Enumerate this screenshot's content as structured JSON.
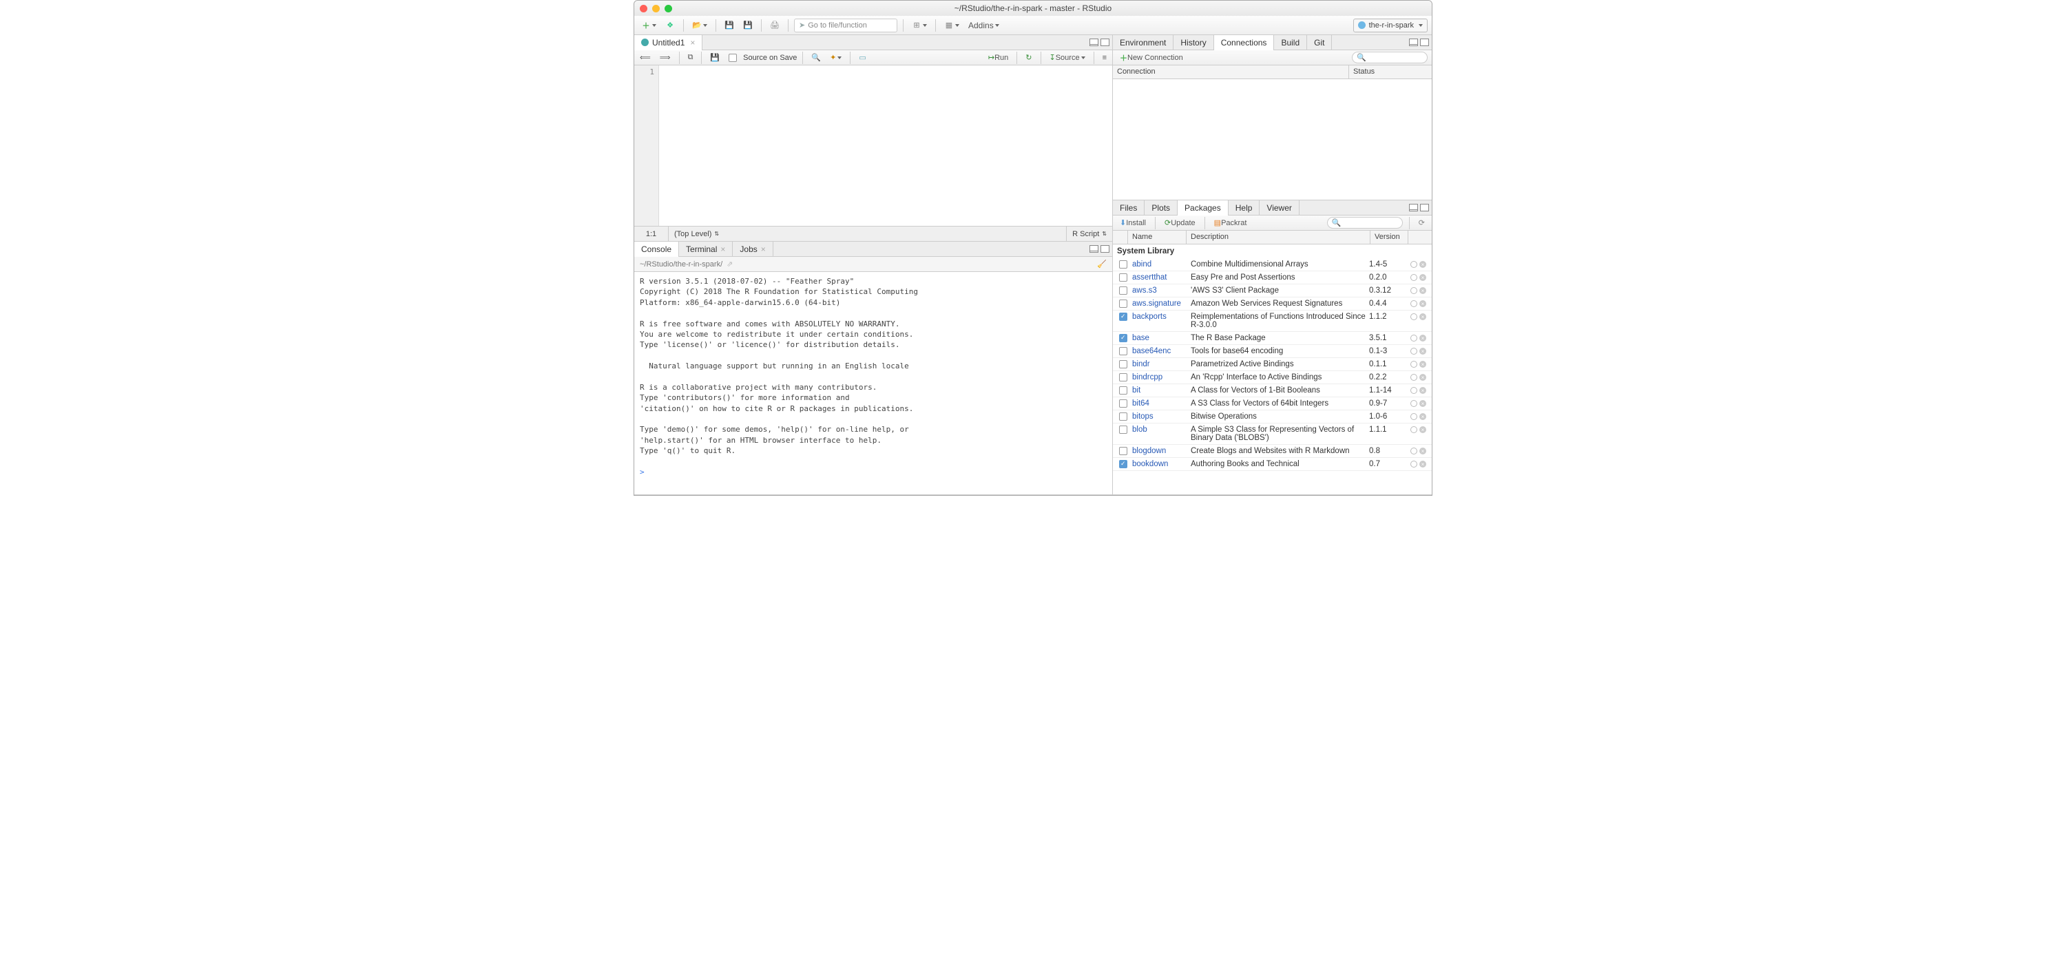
{
  "title": "~/RStudio/the-r-in-spark - master - RStudio",
  "project_name": "the-r-in-spark",
  "mainToolbar": {
    "gotoFile": "Go to file/function",
    "addins": "Addins"
  },
  "source": {
    "tab": "Untitled1",
    "sourceOnSave": "Source on Save",
    "run": "Run",
    "source": "Source",
    "line1": "1",
    "cursor": "1:1",
    "scope": "(Top Level)",
    "type": "R Script"
  },
  "consolePane": {
    "tabs": [
      "Console",
      "Terminal",
      "Jobs"
    ],
    "path": "~/RStudio/the-r-in-spark/",
    "output": "R version 3.5.1 (2018-07-02) -- \"Feather Spray\"\nCopyright (C) 2018 The R Foundation for Statistical Computing\nPlatform: x86_64-apple-darwin15.6.0 (64-bit)\n\nR is free software and comes with ABSOLUTELY NO WARRANTY.\nYou are welcome to redistribute it under certain conditions.\nType 'license()' or 'licence()' for distribution details.\n\n  Natural language support but running in an English locale\n\nR is a collaborative project with many contributors.\nType 'contributors()' for more information and\n'citation()' on how to cite R or R packages in publications.\n\nType 'demo()' for some demos, 'help()' for on-line help, or\n'help.start()' for an HTML browser interface to help.\nType 'q()' to quit R.\n",
    "prompt": ">"
  },
  "env": {
    "tabs": [
      "Environment",
      "History",
      "Connections",
      "Build",
      "Git"
    ],
    "active": "Connections",
    "newConn": "New Connection",
    "cols": [
      "Connection",
      "Status"
    ]
  },
  "pkgs": {
    "tabs": [
      "Files",
      "Plots",
      "Packages",
      "Help",
      "Viewer"
    ],
    "install": "Install",
    "update": "Update",
    "packrat": "Packrat",
    "cols": [
      "Name",
      "Description",
      "Version"
    ],
    "section": "System Library",
    "rows": [
      {
        "c": false,
        "n": "abind",
        "d": "Combine Multidimensional Arrays",
        "v": "1.4-5"
      },
      {
        "c": false,
        "n": "assertthat",
        "d": "Easy Pre and Post Assertions",
        "v": "0.2.0"
      },
      {
        "c": false,
        "n": "aws.s3",
        "d": "'AWS S3' Client Package",
        "v": "0.3.12"
      },
      {
        "c": false,
        "n": "aws.signature",
        "d": "Amazon Web Services Request Signatures",
        "v": "0.4.4"
      },
      {
        "c": true,
        "n": "backports",
        "d": "Reimplementations of Functions Introduced Since R-3.0.0",
        "v": "1.1.2"
      },
      {
        "c": true,
        "n": "base",
        "d": "The R Base Package",
        "v": "3.5.1"
      },
      {
        "c": false,
        "n": "base64enc",
        "d": "Tools for base64 encoding",
        "v": "0.1-3"
      },
      {
        "c": false,
        "n": "bindr",
        "d": "Parametrized Active Bindings",
        "v": "0.1.1"
      },
      {
        "c": false,
        "n": "bindrcpp",
        "d": "An 'Rcpp' Interface to Active Bindings",
        "v": "0.2.2"
      },
      {
        "c": false,
        "n": "bit",
        "d": "A Class for Vectors of 1-Bit Booleans",
        "v": "1.1-14"
      },
      {
        "c": false,
        "n": "bit64",
        "d": "A S3 Class for Vectors of 64bit Integers",
        "v": "0.9-7"
      },
      {
        "c": false,
        "n": "bitops",
        "d": "Bitwise Operations",
        "v": "1.0-6"
      },
      {
        "c": false,
        "n": "blob",
        "d": "A Simple S3 Class for Representing Vectors of Binary Data ('BLOBS')",
        "v": "1.1.1"
      },
      {
        "c": false,
        "n": "blogdown",
        "d": "Create Blogs and Websites with R Markdown",
        "v": "0.8"
      },
      {
        "c": true,
        "n": "bookdown",
        "d": "Authoring Books and Technical",
        "v": "0.7"
      }
    ]
  }
}
